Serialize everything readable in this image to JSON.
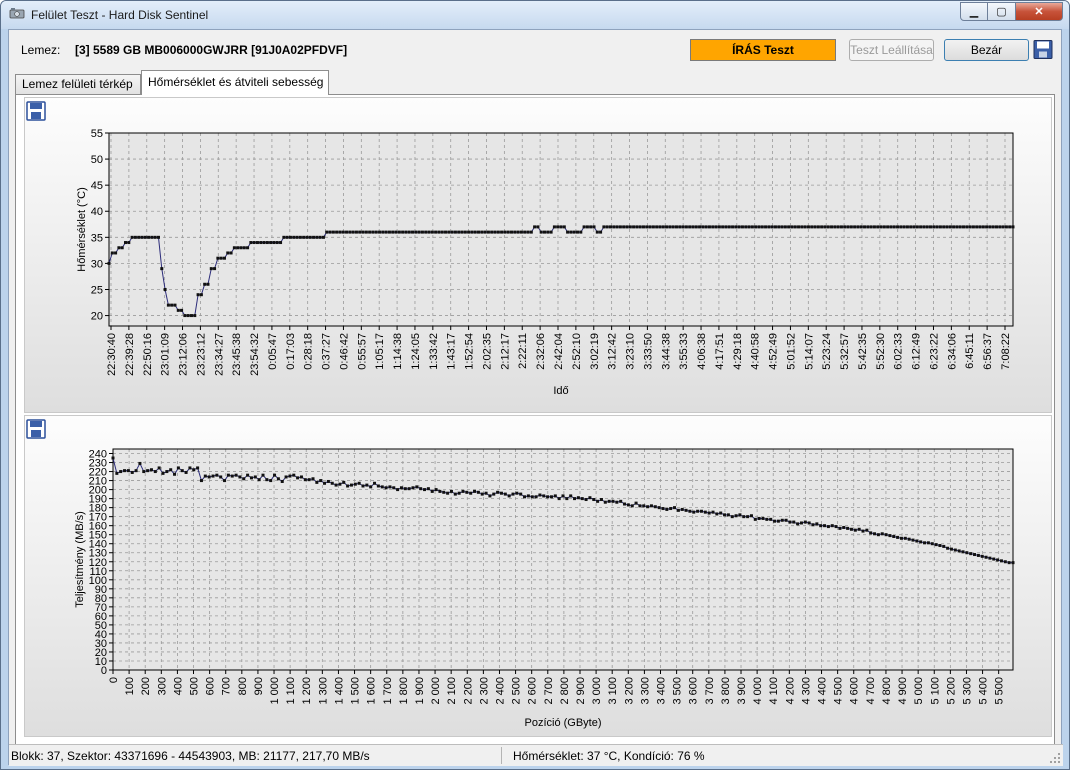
{
  "window": {
    "title": "Felület Teszt - Hard Disk Sentinel",
    "minimize_glyph": "▁",
    "maximize_glyph": "▢",
    "close_glyph": "✕"
  },
  "header": {
    "disk_label": "Lemez:",
    "disk_name": "[3] 5589 GB  MB006000GWJRR [91J0A02PFDVF]",
    "status": "ÍRÁS Teszt",
    "status_color": "#ffa500",
    "stop_label": "Teszt Leállítása",
    "close_label": "Bezár"
  },
  "tabs": [
    {
      "label": "Lemez felületi térkép"
    },
    {
      "label": "Hőmérséklet és átviteli sebesség"
    }
  ],
  "icons": {
    "save": "floppy-disk-icon"
  },
  "chart_data": [
    {
      "type": "line",
      "xlabel": "Idő",
      "ylabel": "Hőmérséklet (°C)",
      "ylim": [
        18,
        55
      ],
      "yticks": [
        20,
        25,
        30,
        35,
        40,
        45,
        50,
        55
      ],
      "grid": true,
      "line_color": "#2c2c7a",
      "x_ticks": [
        "22:30:40",
        "22:39:28",
        "22:50:16",
        "23:01:09",
        "23:12:06",
        "23:23:12",
        "23:34:27",
        "23:45:38",
        "23:54:32",
        "0:05:47",
        "0:17:03",
        "0:28:18",
        "0:37:27",
        "0:46:42",
        "0:55:57",
        "1:05:17",
        "1:14:38",
        "1:24:05",
        "1:33:42",
        "1:43:17",
        "1:52:54",
        "2:02:35",
        "2:12:17",
        "2:22:11",
        "2:32:06",
        "2:42:04",
        "2:52:10",
        "3:02:19",
        "3:12:42",
        "3:23:10",
        "3:33:50",
        "3:44:38",
        "3:55:33",
        "4:06:38",
        "4:17:51",
        "4:29:18",
        "4:40:58",
        "4:52:49",
        "5:01:52",
        "5:14:07",
        "5:23:24",
        "5:32:57",
        "5:42:35",
        "5:52:30",
        "6:02:33",
        "6:12:49",
        "6:23:22",
        "6:34:06",
        "6:45:11",
        "6:56:37",
        "7:08:22"
      ],
      "series": [
        {
          "values": [
            30,
            32,
            32,
            33,
            33,
            34,
            34,
            35,
            35,
            35,
            35,
            35,
            35,
            35,
            35,
            35,
            29,
            25,
            22,
            22,
            22,
            21,
            21,
            20,
            20,
            20,
            20,
            24,
            24,
            26,
            26,
            29,
            29,
            31,
            31,
            31,
            32,
            32,
            33,
            33,
            33,
            33,
            33,
            34,
            34,
            34,
            34,
            34,
            34,
            34,
            34,
            34,
            34,
            35,
            35,
            35,
            35,
            35,
            35,
            35,
            35,
            35,
            35,
            35,
            35,
            35,
            36,
            36,
            36,
            36,
            36,
            36,
            36,
            36,
            36,
            36,
            36,
            36,
            36,
            36,
            36,
            36,
            36,
            36,
            36,
            36,
            36,
            36,
            36,
            36,
            36,
            36,
            36,
            36,
            36,
            36,
            36,
            36,
            36,
            36,
            36,
            36,
            36,
            36,
            36,
            36,
            36,
            36,
            36,
            36,
            36,
            36,
            36,
            36,
            36,
            36,
            36,
            36,
            36,
            36,
            36,
            36,
            36,
            36,
            36,
            36,
            36,
            36,
            36,
            37,
            37,
            36,
            36,
            36,
            36,
            37,
            37,
            37,
            37,
            36,
            36,
            36,
            36,
            36,
            37,
            37,
            37,
            37,
            36,
            36,
            37,
            37,
            37,
            37,
            37,
            37,
            37,
            37,
            37,
            37,
            37,
            37,
            37,
            37,
            37,
            37,
            37,
            37,
            37,
            37,
            37,
            37,
            37,
            37,
            37,
            37,
            37,
            37,
            37,
            37,
            37,
            37,
            37,
            37,
            37,
            37,
            37,
            37,
            37,
            37,
            37,
            37,
            37,
            37,
            37,
            37,
            37,
            37,
            37,
            37,
            37,
            37,
            37,
            37,
            37,
            37,
            37,
            37,
            37,
            37,
            37,
            37,
            37,
            37,
            37,
            37,
            37,
            37,
            37,
            37,
            37,
            37,
            37,
            37,
            37,
            37,
            37,
            37,
            37,
            37,
            37,
            37,
            37,
            37,
            37,
            37,
            37,
            37,
            37,
            37,
            37,
            37,
            37,
            37,
            37,
            37,
            37,
            37,
            37,
            37,
            37,
            37,
            37,
            37,
            37,
            37,
            37,
            37,
            37,
            37,
            37,
            37,
            37,
            37,
            37,
            37,
            37,
            37,
            37,
            37,
            37,
            37,
            37,
            37,
            37
          ]
        }
      ]
    },
    {
      "type": "line",
      "xlabel": "Pozíció (GByte)",
      "ylabel": "Teljesítmény (MB/s)",
      "ylim": [
        0,
        245
      ],
      "yticks": [
        0,
        10,
        20,
        30,
        40,
        50,
        60,
        70,
        80,
        90,
        100,
        110,
        120,
        130,
        140,
        150,
        160,
        170,
        180,
        190,
        200,
        210,
        220,
        230,
        240
      ],
      "x_ticks": [
        "0",
        "100",
        "200",
        "300",
        "400",
        "500",
        "600",
        "700",
        "800",
        "900",
        "1 000",
        "1 100",
        "1 200",
        "1 300",
        "1 400",
        "1 500",
        "1 600",
        "1 700",
        "1 800",
        "1 900",
        "2 000",
        "2 100",
        "2 200",
        "2 300",
        "2 400",
        "2 500",
        "2 600",
        "2 700",
        "2 800",
        "2 900",
        "3 000",
        "3 100",
        "3 200",
        "3 300",
        "3 400",
        "3 500",
        "3 600",
        "3 700",
        "3 800",
        "3 900",
        "4 000",
        "4 100",
        "4 200",
        "4 300",
        "4 400",
        "4 500",
        "4 600",
        "4 700",
        "4 800",
        "4 900",
        "5 000",
        "5 100",
        "5 200",
        "5 300",
        "5 400",
        "5 500"
      ],
      "x_max": 5589,
      "grid": true,
      "line_color": "#2c2c7a",
      "series": [
        {
          "values": [
            235,
            218,
            220,
            221,
            221,
            219,
            221,
            229,
            220,
            221,
            222,
            220,
            224,
            218,
            220,
            222,
            217,
            224,
            221,
            219,
            224,
            222,
            224,
            210,
            215,
            214,
            215,
            216,
            214,
            210,
            216,
            215,
            216,
            214,
            212,
            216,
            213,
            214,
            211,
            216,
            211,
            210,
            216,
            212,
            209,
            214,
            215,
            216,
            213,
            214,
            211,
            211,
            212,
            208,
            210,
            207,
            209,
            207,
            205,
            206,
            208,
            204,
            205,
            206,
            207,
            204,
            205,
            203,
            207,
            204,
            203,
            202,
            203,
            202,
            200,
            202,
            201,
            201,
            202,
            203,
            201,
            200,
            201,
            198,
            200,
            198,
            197,
            196,
            198,
            195,
            196,
            198,
            197,
            196,
            198,
            197,
            195,
            196,
            193,
            195,
            197,
            196,
            195,
            193,
            195,
            196,
            195,
            192,
            193,
            192,
            192,
            194,
            193,
            192,
            192,
            193,
            190,
            193,
            190,
            193,
            190,
            191,
            190,
            189,
            191,
            189,
            187,
            189,
            186,
            187,
            187,
            186,
            187,
            184,
            183,
            182,
            185,
            182,
            182,
            181,
            182,
            181,
            180,
            179,
            178,
            179,
            180,
            177,
            178,
            177,
            176,
            175,
            176,
            176,
            175,
            174,
            175,
            173,
            174,
            172,
            172,
            170,
            171,
            172,
            170,
            170,
            171,
            167,
            168,
            168,
            167,
            167,
            165,
            165,
            166,
            166,
            164,
            164,
            162,
            163,
            164,
            163,
            161,
            162,
            160,
            160,
            159,
            160,
            159,
            157,
            158,
            157,
            156,
            155,
            156,
            154,
            155,
            152,
            151,
            150,
            151,
            150,
            149,
            148,
            147,
            146,
            146,
            145,
            144,
            143,
            142,
            141,
            141,
            140,
            139,
            138,
            137,
            135,
            134,
            133,
            132,
            131,
            130,
            129,
            128,
            127,
            126,
            125,
            124,
            123,
            122,
            121,
            120,
            119,
            119
          ]
        }
      ]
    }
  ],
  "statusbar": {
    "left": "Blokk: 37, Szektor: 43371696 - 44543903, MB: 21177, 217,70 MB/s",
    "right": "Hőmérséklet: 37  °C,  Kondíció: 76 %"
  }
}
